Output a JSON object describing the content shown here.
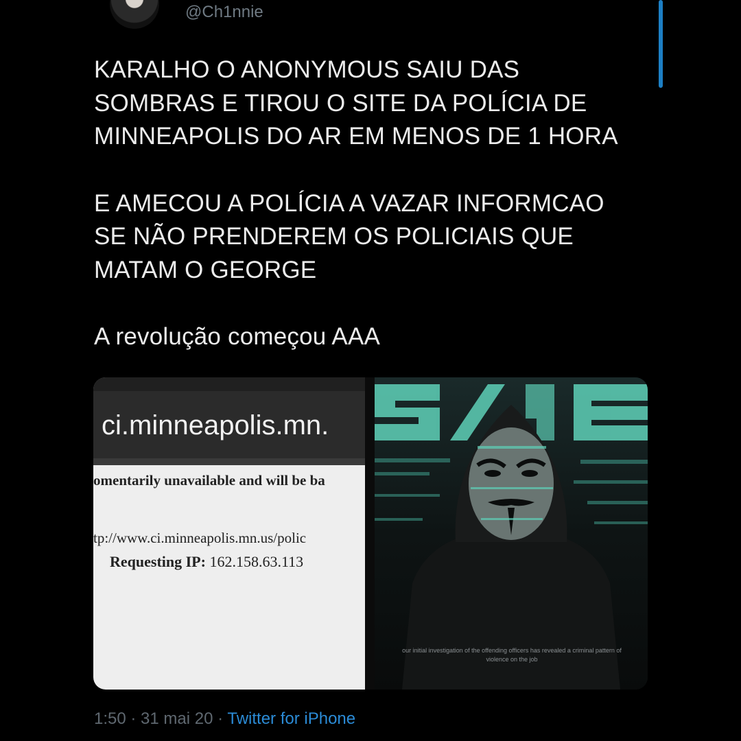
{
  "tweet": {
    "handle": "@Ch1nnie",
    "paragraphs": [
      "KARALHO O ANONYMOUS SAIU DAS\nSOMBRAS E TIROU O SITE DA POLÍCIA DE\nMINNEAPOLIS DO AR EM MENOS DE 1 HORA",
      "E AMECOU A POLÍCIA A VAZAR INFORMCAO\nSE NÃO PRENDEREM OS POLICIAIS QUE\nMATAM O GEORGE",
      "A revolução começou AAA"
    ],
    "time": "1:50",
    "separator": " · ",
    "date": "31 mai 20",
    "source": "Twitter for iPhone"
  },
  "media": {
    "left": {
      "url_text": "ci.minneapolis.mn.",
      "unavailable_text": "omentarily unavailable and will be ba",
      "link_text": "tp://www.ci.minneapolis.mn.us/polic",
      "requesting_label": "Requesting IP:",
      "requesting_ip": "162.158.63.113"
    },
    "right": {
      "caption": "our initial investigation of the offending officers has revealed a criminal pattern of violence on the job"
    }
  },
  "colors": {
    "background": "#000000",
    "link_blue": "#2b8bd6",
    "glitch_green": "#5fd1b8"
  }
}
